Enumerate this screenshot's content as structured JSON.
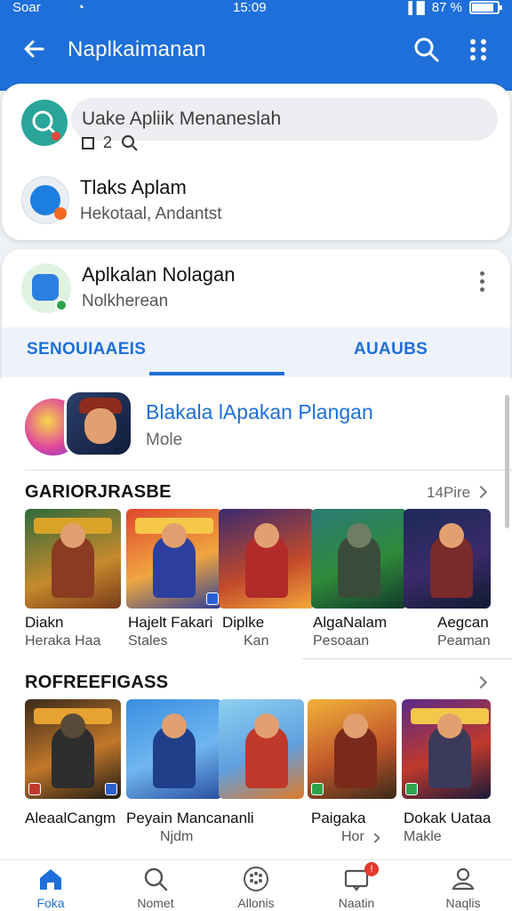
{
  "status_bar": {
    "carrier": "Soar",
    "time": "15:09",
    "battery": "87 %",
    "battery_level": 0.87
  },
  "header": {
    "title": "Naplkaimanan"
  },
  "account_card": {
    "search_placeholder": "Uake Apliik Menaneslah",
    "mini_count": "2",
    "item_title": "Tlaks Aplam",
    "item_subtitle": "Hekotaal, Andantst"
  },
  "app_card": {
    "title": "Aplkalan Nolagan",
    "subtitle": "Nolkherean",
    "tabs": [
      {
        "label": "SENOUIAAEIS",
        "active": true
      },
      {
        "label": "AUAUBS",
        "active": false
      }
    ]
  },
  "featured": {
    "title": "Blakala lApakan Plangan",
    "subtitle": "Mole"
  },
  "section1": {
    "title": "GARIORJRASBE",
    "more": "14Pire",
    "games": [
      {
        "name": "Diakn",
        "sub": "Heraka Haa"
      },
      {
        "name": "Hajelt Fakari",
        "sub": "Stales"
      },
      {
        "name": "Diplke",
        "sub": "Kan"
      },
      {
        "name": "AlgaNalam",
        "sub": "Pesoaan"
      },
      {
        "name": "Aegcan",
        "sub": "Peaman"
      }
    ]
  },
  "section2": {
    "title": "ROFREEFIGASS",
    "games": [
      {
        "name": "AleaalCangm",
        "sub": ""
      },
      {
        "name": "Peyain Mancananli",
        "sub": "Njdm"
      },
      {
        "name": "",
        "sub": ""
      },
      {
        "name": "Paigaka",
        "sub": "Hor"
      },
      {
        "name": "Dokak Uataa",
        "sub": "Makle"
      }
    ]
  },
  "bottom_nav": [
    {
      "label": "Foka",
      "icon": "home-icon",
      "active": true
    },
    {
      "label": "Nomet",
      "icon": "search-icon",
      "active": false
    },
    {
      "label": "Allonis",
      "icon": "games-icon",
      "active": false
    },
    {
      "label": "Naatin",
      "icon": "notifications-icon",
      "active": false,
      "badge": "!"
    },
    {
      "label": "Naqlis",
      "icon": "profile-icon",
      "active": false
    }
  ],
  "colors": {
    "primary": "#1e6fd9",
    "background": "#eef1f5"
  }
}
